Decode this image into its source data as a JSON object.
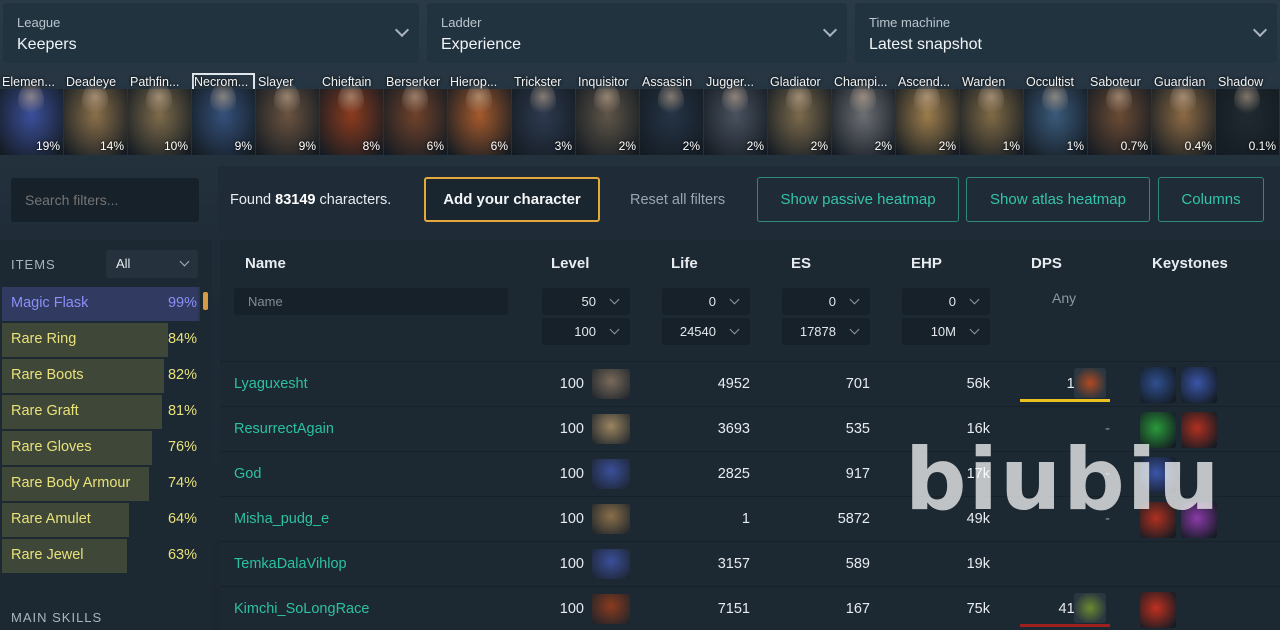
{
  "filters": {
    "league": {
      "label": "League",
      "value": "Keepers"
    },
    "ladder": {
      "label": "Ladder",
      "value": "Experience"
    },
    "time_machine": {
      "label": "Time machine",
      "value": "Latest snapshot"
    }
  },
  "classes": [
    {
      "name": "Elemen...",
      "pct": "19%",
      "color": "#3b4f9a"
    },
    {
      "name": "Deadeye",
      "pct": "14%",
      "color": "#8a6f49"
    },
    {
      "name": "Pathfin...",
      "pct": "10%",
      "color": "#7d6b4a"
    },
    {
      "name": "Necrom...",
      "pct": "9%",
      "color": "#34507a"
    },
    {
      "name": "Slayer",
      "pct": "9%",
      "color": "#6a5340"
    },
    {
      "name": "Chieftain",
      "pct": "8%",
      "color": "#8b3b1e"
    },
    {
      "name": "Berserker",
      "pct": "6%",
      "color": "#70422b"
    },
    {
      "name": "Hierop...",
      "pct": "6%",
      "color": "#a55a2c"
    },
    {
      "name": "Trickster",
      "pct": "3%",
      "color": "#2d3a4f"
    },
    {
      "name": "Inquisitor",
      "pct": "2%",
      "color": "#5f5548"
    },
    {
      "name": "Assassin",
      "pct": "2%",
      "color": "#253446"
    },
    {
      "name": "Jugger...",
      "pct": "2%",
      "color": "#4a5260"
    },
    {
      "name": "Gladiator",
      "pct": "2%",
      "color": "#7c6a4c"
    },
    {
      "name": "Champi...",
      "pct": "2%",
      "color": "#6c6f74"
    },
    {
      "name": "Ascend...",
      "pct": "2%",
      "color": "#9c7c4a"
    },
    {
      "name": "Warden",
      "pct": "1%",
      "color": "#806a45"
    },
    {
      "name": "Occultist",
      "pct": "1%",
      "color": "#3a5a7a"
    },
    {
      "name": "Saboteur",
      "pct": "0.7%",
      "color": "#6b4b34"
    },
    {
      "name": "Guardian",
      "pct": "0.4%",
      "color": "#8c6a44"
    },
    {
      "name": "Shadow",
      "pct": "0.1%",
      "color": "#1f2a30"
    }
  ],
  "search": {
    "placeholder": "Search filters..."
  },
  "toolbar": {
    "found_prefix": "Found",
    "found_count": "83149",
    "found_suffix": "characters.",
    "add_label": "Add your character",
    "reset_label": "Reset all filters",
    "passive_label": "Show passive heatmap",
    "atlas_label": "Show atlas heatmap",
    "columns_label": "Columns"
  },
  "items_panel": {
    "header": "ITEMS",
    "filter_value": "All",
    "rows": [
      {
        "name": "Magic Flask",
        "pct": "99%",
        "frac": 0.99,
        "color": "#8b8ff7"
      },
      {
        "name": "Rare Ring",
        "pct": "84%",
        "frac": 0.84,
        "color": "#e9e27a"
      },
      {
        "name": "Rare Boots",
        "pct": "82%",
        "frac": 0.82,
        "color": "#e9e27a"
      },
      {
        "name": "Rare Graft",
        "pct": "81%",
        "frac": 0.81,
        "color": "#e9e27a"
      },
      {
        "name": "Rare Gloves",
        "pct": "76%",
        "frac": 0.76,
        "color": "#e9e27a"
      },
      {
        "name": "Rare Body Armour",
        "pct": "74%",
        "frac": 0.74,
        "color": "#e9e27a"
      },
      {
        "name": "Rare Amulet",
        "pct": "64%",
        "frac": 0.64,
        "color": "#e9e27a"
      },
      {
        "name": "Rare Jewel",
        "pct": "63%",
        "frac": 0.63,
        "color": "#e9e27a"
      }
    ],
    "main_skills_header": "MAIN SKILLS"
  },
  "table": {
    "headers": {
      "name": "Name",
      "level": "Level",
      "life": "Life",
      "es": "ES",
      "ehp": "EHP",
      "dps": "DPS",
      "keystones": "Keystones"
    },
    "name_placeholder": "Name",
    "level_min": "50",
    "level_max": "100",
    "life_min": "0",
    "life_max": "24540",
    "es_min": "0",
    "es_max": "17878",
    "ehp_min": "0",
    "ehp_max": "10M",
    "dps_any": "Any",
    "rows": [
      {
        "name": "Lyaguxesht",
        "level": "100",
        "life": "4952",
        "es": "701",
        "ehp": "56k",
        "dps": "12k",
        "avatar_color": "#7a6a5a",
        "dps_color": "#e8c020",
        "keystones": [
          "#2f4f8f",
          "#3a55a8"
        ]
      },
      {
        "name": "ResurrectAgain",
        "level": "100",
        "life": "3693",
        "es": "535",
        "ehp": "16k",
        "dps": "-",
        "avatar_color": "#9c8460",
        "dps_color": "",
        "keystones": [
          "#2a9a3a",
          "#b03020"
        ]
      },
      {
        "name": "God",
        "level": "100",
        "life": "2825",
        "es": "917",
        "ehp": "17k",
        "dps": "-",
        "avatar_color": "#3b4f9a",
        "dps_color": "",
        "keystones": [
          "#3a55a8"
        ]
      },
      {
        "name": "Misha_pudg_e",
        "level": "100",
        "life": "1",
        "es": "5872",
        "ehp": "49k",
        "dps": "-",
        "avatar_color": "#8a6f49",
        "dps_color": "",
        "keystones": [
          "#b03020",
          "#8a3aa8"
        ]
      },
      {
        "name": "TemkaDalaVihlop",
        "level": "100",
        "life": "3157",
        "es": "589",
        "ehp": "19k",
        "dps": "",
        "avatar_color": "#3b4f9a",
        "dps_color": "",
        "keystones": []
      },
      {
        "name": "Kimchi_SoLongRace",
        "level": "100",
        "life": "7151",
        "es": "167",
        "ehp": "75k",
        "dps": "414k",
        "avatar_color": "#8b3b1e",
        "dps_color": "#a02020",
        "keystones": [
          "#c03020"
        ]
      }
    ]
  },
  "watermark": "biubiu"
}
